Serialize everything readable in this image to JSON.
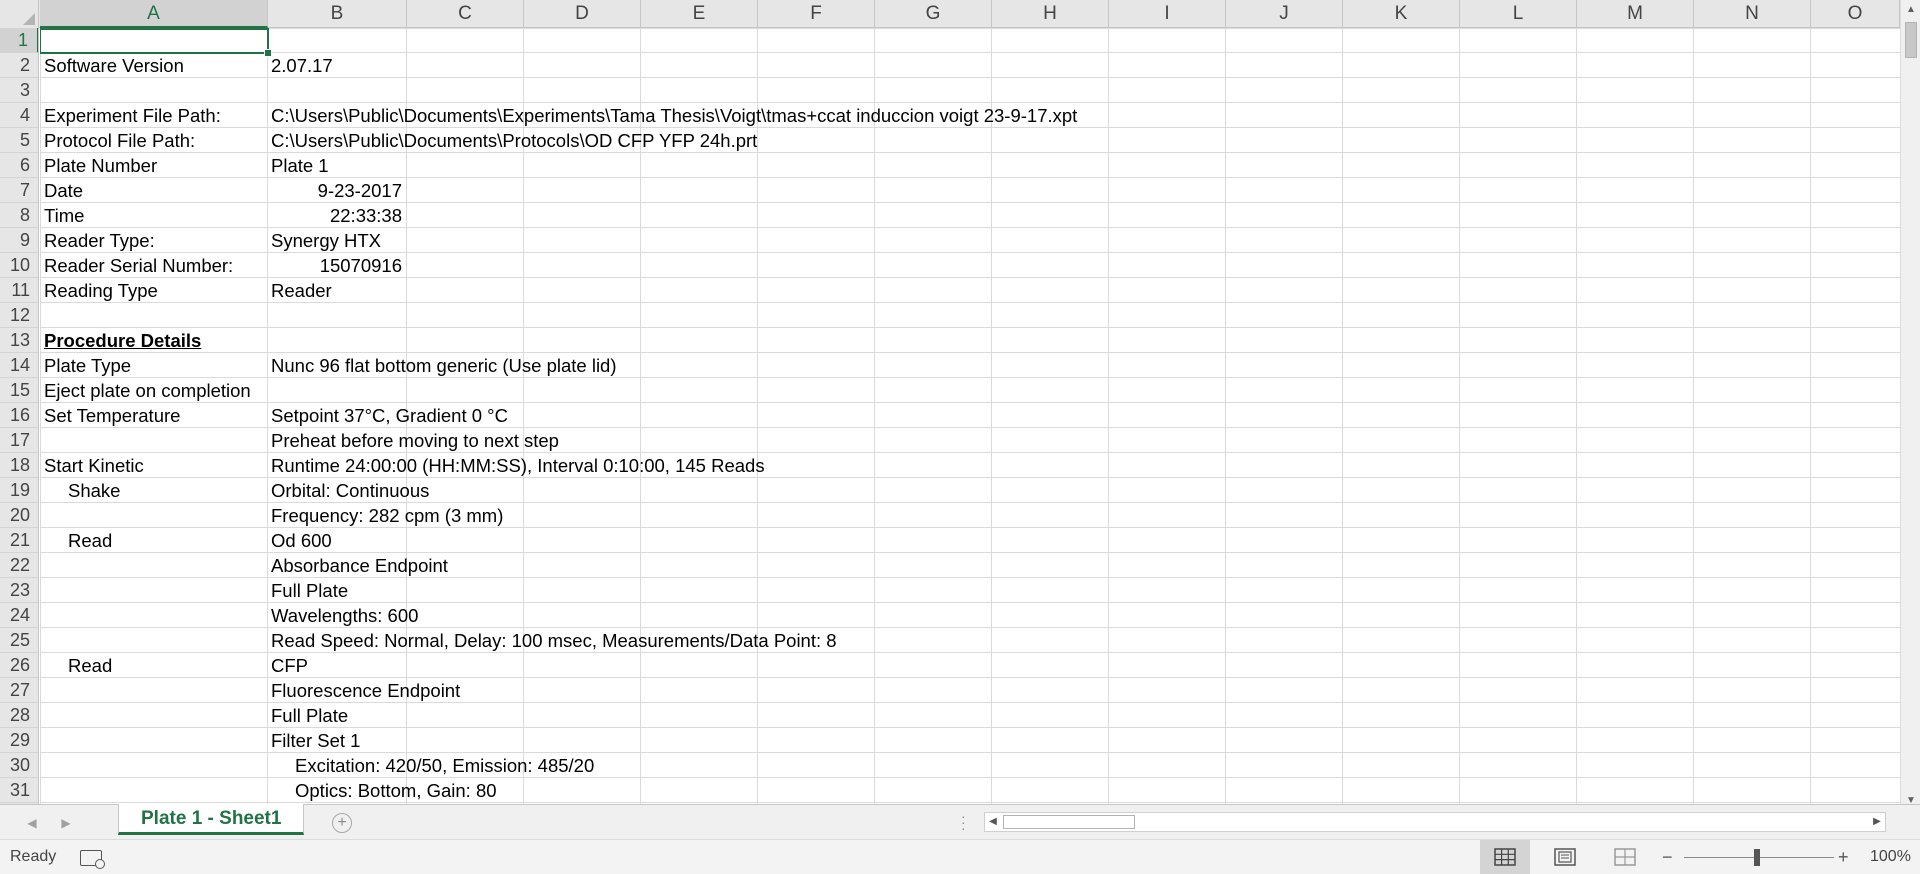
{
  "columns": [
    "A",
    "B",
    "C",
    "D",
    "E",
    "F",
    "G",
    "H",
    "I",
    "J",
    "K",
    "L",
    "M",
    "N",
    "O"
  ],
  "rows": [
    "1",
    "2",
    "3",
    "4",
    "5",
    "6",
    "7",
    "8",
    "9",
    "10",
    "11",
    "12",
    "13",
    "14",
    "15",
    "16",
    "17",
    "18",
    "19",
    "20",
    "21",
    "22",
    "23",
    "24",
    "25",
    "26",
    "27",
    "28",
    "29",
    "30",
    "31"
  ],
  "cells": {
    "r2": {
      "a": "Software Version",
      "b": "2.07.17"
    },
    "r4": {
      "a": "Experiment File Path:",
      "b": "C:\\Users\\Public\\Documents\\Experiments\\Tama Thesis\\Voigt\\tmas+ccat induccion voigt 23-9-17.xpt"
    },
    "r5": {
      "a": "Protocol File Path:",
      "b": "C:\\Users\\Public\\Documents\\Protocols\\OD CFP YFP 24h.prt"
    },
    "r6": {
      "a": "Plate Number",
      "b": "Plate 1"
    },
    "r7": {
      "a": "Date",
      "b": "9-23-2017"
    },
    "r8": {
      "a": "Time",
      "b": "22:33:38"
    },
    "r9": {
      "a": "Reader Type:",
      "b": "Synergy HTX"
    },
    "r10": {
      "a": "Reader Serial Number:",
      "b": "15070916"
    },
    "r11": {
      "a": "Reading Type",
      "b": "Reader"
    },
    "r13": {
      "a": "Procedure Details"
    },
    "r14": {
      "a": "Plate Type",
      "b": "Nunc 96 flat bottom generic (Use plate lid)"
    },
    "r15": {
      "a": "Eject plate on completion"
    },
    "r16": {
      "a": "Set Temperature",
      "b": "Setpoint 37°C, Gradient 0 °C"
    },
    "r17": {
      "b": "Preheat before moving to next step"
    },
    "r18": {
      "a": "Start Kinetic",
      "b": "Runtime 24:00:00 (HH:MM:SS), Interval 0:10:00, 145 Reads"
    },
    "r19": {
      "a": "Shake",
      "b": "Orbital: Continuous"
    },
    "r20": {
      "b": "Frequency: 282 cpm (3 mm)"
    },
    "r21": {
      "a": "Read",
      "b": "Od 600"
    },
    "r22": {
      "b": "Absorbance Endpoint"
    },
    "r23": {
      "b": "Full Plate"
    },
    "r24": {
      "b": "Wavelengths:  600"
    },
    "r25": {
      "b": "Read Speed: Normal,  Delay: 100 msec,  Measurements/Data Point: 8"
    },
    "r26": {
      "a": "Read",
      "b": "CFP"
    },
    "r27": {
      "b": "Fluorescence Endpoint"
    },
    "r28": {
      "b": "Full Plate"
    },
    "r29": {
      "b": "Filter Set 1"
    },
    "r30": {
      "b": "Excitation: 420/50,  Emission: 485/20"
    },
    "r31": {
      "b": "Optics: Bottom,  Gain: 80"
    }
  },
  "sheet_tab": "Plate 1 - Sheet1",
  "status": "Ready",
  "zoom": "100%",
  "colors": {
    "accent": "#217346"
  },
  "icons": {
    "add_sheet": "plus-circle-icon",
    "macro": "macro-record-icon",
    "normal_view": "grid-icon",
    "page_layout": "page-layout-icon",
    "page_break": "page-break-icon"
  }
}
